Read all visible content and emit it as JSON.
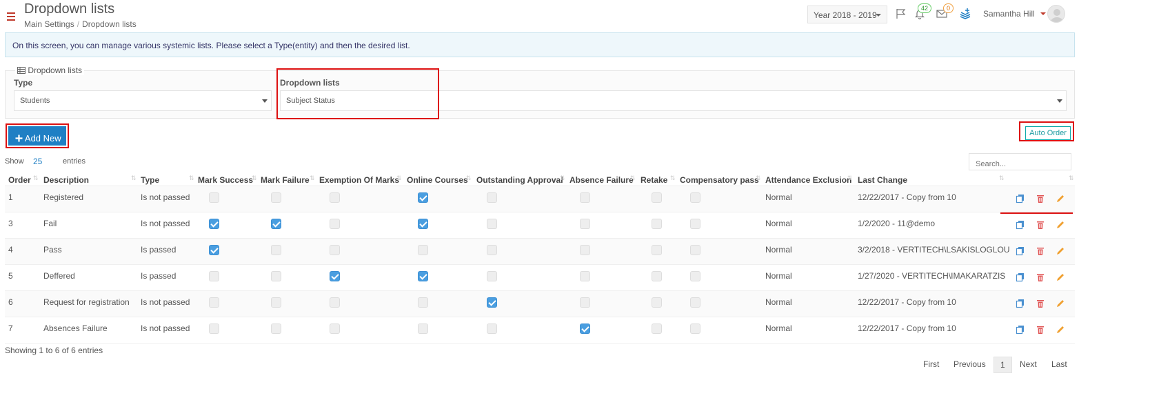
{
  "header": {
    "title": "Dropdown lists",
    "breadcrumb": [
      "Main Settings",
      "Dropdown lists"
    ],
    "year_select": "Year 2018 - 2019",
    "notifications_count": "42",
    "messages_count": "0",
    "user_name": "Samantha Hill"
  },
  "info_text": "On this screen, you can manage various systemic lists. Please select a Type(entity) and then the desired list.",
  "filter": {
    "legend": "Dropdown lists",
    "type_label": "Type",
    "type_value": "Students",
    "list_label": "Dropdown lists",
    "list_value": "Subject Status"
  },
  "toolbar": {
    "add_new_label": "Add New",
    "auto_order_label": "Auto Order",
    "show_label": "Show",
    "show_value": "25",
    "entries_label": "entries",
    "search_placeholder": "Search..."
  },
  "table": {
    "columns": [
      "Order",
      "Description",
      "Type",
      "Mark Success",
      "Mark Failure",
      "Exemption Of Marks",
      "Online Courses",
      "Outstanding Approval",
      "Absence Failure",
      "Retake",
      "Compensatory pass",
      "Attendance Exclusion",
      "Last Change"
    ],
    "rows": [
      {
        "order": "1",
        "description": "Registered",
        "type": "Is not passed",
        "checks": [
          false,
          false,
          false,
          true,
          false,
          false,
          false,
          false
        ],
        "attendance": "Normal",
        "last_change": "12/22/2017 - Copy from 10"
      },
      {
        "order": "3",
        "description": "Fail",
        "type": "Is not passed",
        "checks": [
          true,
          true,
          false,
          true,
          false,
          false,
          false,
          false
        ],
        "attendance": "Normal",
        "last_change": "1/2/2020 - 11@demo"
      },
      {
        "order": "4",
        "description": "Pass",
        "type": "Is passed",
        "checks": [
          true,
          false,
          false,
          false,
          false,
          false,
          false,
          false
        ],
        "attendance": "Normal",
        "last_change": "3/2/2018 - VERTITECH\\LSAKISLOGLOU"
      },
      {
        "order": "5",
        "description": "Deffered",
        "type": "Is passed",
        "checks": [
          false,
          false,
          true,
          true,
          false,
          false,
          false,
          false
        ],
        "attendance": "Normal",
        "last_change": "1/27/2020 - VERTITECH\\IMAKARATZIS"
      },
      {
        "order": "6",
        "description": "Request for registration",
        "type": "Is not passed",
        "checks": [
          false,
          false,
          false,
          false,
          true,
          false,
          false,
          false
        ],
        "attendance": "Normal",
        "last_change": "12/22/2017 - Copy from 10"
      },
      {
        "order": "7",
        "description": "Absences Failure",
        "type": "Is not passed",
        "checks": [
          false,
          false,
          false,
          false,
          false,
          true,
          false,
          false
        ],
        "attendance": "Normal",
        "last_change": "12/22/2017 - Copy from 10"
      }
    ]
  },
  "footer": {
    "info": "Showing 1 to 6 of 6 entries",
    "first": "First",
    "previous": "Previous",
    "page": "1",
    "next": "Next",
    "last": "Last"
  },
  "colors": {
    "accent": "#1f7fc4",
    "highlight": "#dd1111",
    "checked": "#4a9ee0",
    "delete": "#e05555",
    "edit": "#f0a030"
  },
  "icons": [
    "menu-icon",
    "caret-down-icon",
    "flag-icon",
    "bell-icon",
    "envelope-icon",
    "layers-icon",
    "avatar-icon",
    "table-icon",
    "plus-icon",
    "copy-icon",
    "trash-icon",
    "pencil-icon",
    "sort-icon"
  ]
}
